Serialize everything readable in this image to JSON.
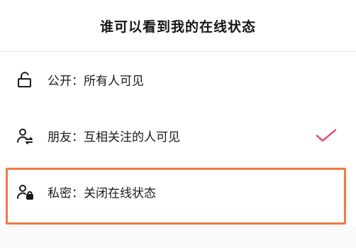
{
  "header": {
    "title": "谁可以看到我的在线状态"
  },
  "options": [
    {
      "key": "public",
      "label": "公开：所有人可见",
      "icon": "unlock-icon",
      "selected": false
    },
    {
      "key": "friends",
      "label": "朋友：互相关注的人可见",
      "icon": "user-mutual-icon",
      "selected": true
    },
    {
      "key": "private",
      "label": "私密：关闭在线状态",
      "icon": "user-lock-icon",
      "selected": false,
      "highlighted": true
    }
  ],
  "colors": {
    "check": "#ee4e7a",
    "highlight_border": "#ee7a45",
    "divider": "#e6e6e6"
  }
}
